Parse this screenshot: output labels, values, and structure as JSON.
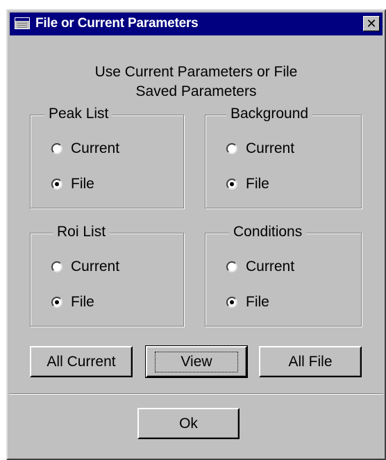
{
  "window": {
    "title": "File or Current Parameters",
    "close_glyph": "✕",
    "prompt_line1": "Use Current Parameters or File",
    "prompt_line2": "Saved Parameters"
  },
  "groups": [
    {
      "label": "Peak List",
      "options": [
        "Current",
        "File"
      ],
      "selected": "File"
    },
    {
      "label": "Background",
      "options": [
        "Current",
        "File"
      ],
      "selected": "File"
    },
    {
      "label": "Roi List",
      "options": [
        "Current",
        "File"
      ],
      "selected": "File"
    },
    {
      "label": "Conditions",
      "options": [
        "Current",
        "File"
      ],
      "selected": "File"
    }
  ],
  "buttons": {
    "all_current": "All Current",
    "view": "View",
    "all_file": "All File",
    "ok": "Ok"
  },
  "icons": {
    "window_icon": "window-icon",
    "close_icon": "close-icon"
  },
  "colors": {
    "title_bar": "#000080",
    "face": "#c0c0c0"
  }
}
